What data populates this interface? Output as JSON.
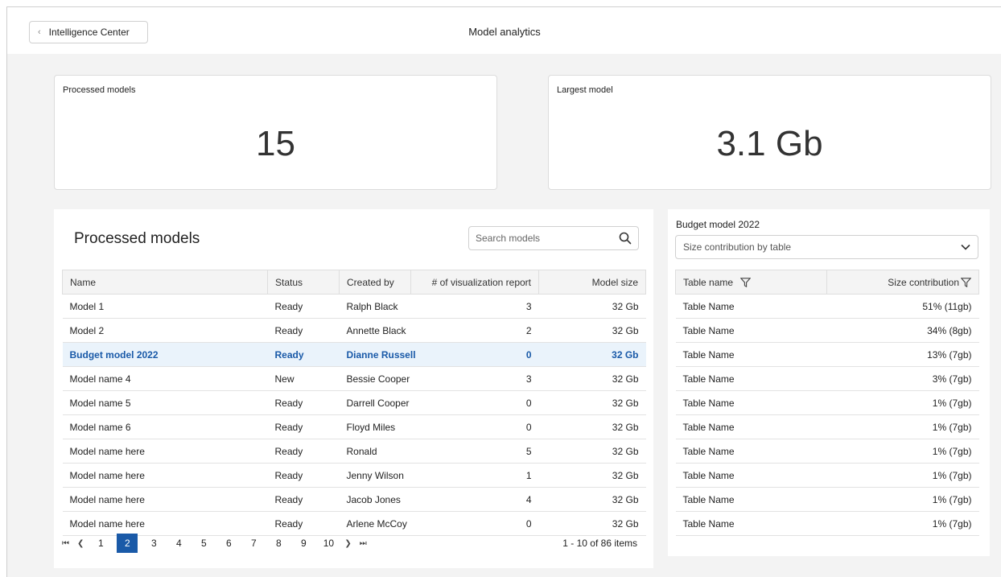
{
  "header": {
    "back_label": "Intelligence Center",
    "title": "Model analytics"
  },
  "kpis": [
    {
      "label": "Processed models",
      "value": "15"
    },
    {
      "label": "Largest model",
      "value": "3.1 Gb"
    }
  ],
  "models_panel": {
    "title": "Processed models",
    "search_placeholder": "Search models",
    "columns": [
      "Name",
      "Status",
      "Created by",
      "# of visualization report",
      "Model size"
    ],
    "rows": [
      {
        "name": "Model 1",
        "status": "Ready",
        "created_by": "Ralph Black",
        "reports": "3",
        "size": "32 Gb"
      },
      {
        "name": "Model 2",
        "status": "Ready",
        "created_by": "Annette Black",
        "reports": "2",
        "size": "32 Gb"
      },
      {
        "name": "Budget model 2022",
        "status": "Ready",
        "created_by": "Dianne Russell",
        "reports": "0",
        "size": "32 Gb"
      },
      {
        "name": "Model name 4",
        "status": "New",
        "created_by": "Bessie Cooper",
        "reports": "3",
        "size": "32 Gb"
      },
      {
        "name": "Model name 5",
        "status": "Ready",
        "created_by": "Darrell Cooper",
        "reports": "0",
        "size": "32 Gb"
      },
      {
        "name": "Model name 6",
        "status": "Ready",
        "created_by": "Floyd Miles",
        "reports": "0",
        "size": "32 Gb"
      },
      {
        "name": "Model name here",
        "status": "Ready",
        "created_by": "Ronald",
        "reports": "5",
        "size": "32 Gb"
      },
      {
        "name": "Model name here",
        "status": "Ready",
        "created_by": "Jenny Wilson",
        "reports": "1",
        "size": "32 Gb"
      },
      {
        "name": "Model name here",
        "status": "Ready",
        "created_by": "Jacob Jones",
        "reports": "4",
        "size": "32 Gb"
      },
      {
        "name": "Model name here",
        "status": "Ready",
        "created_by": "Arlene McCoy",
        "reports": "0",
        "size": "32 Gb"
      }
    ],
    "selected_row": 2,
    "pagination": {
      "pages": [
        "1",
        "2",
        "3",
        "4",
        "5",
        "6",
        "7",
        "8",
        "9",
        "10"
      ],
      "current_page": "2",
      "summary": "1 - 10 of 86 items"
    }
  },
  "detail_panel": {
    "title": "Budget model 2022",
    "view_select": "Size contribution by table",
    "columns": [
      "Table name",
      "Size contribution"
    ],
    "rows": [
      {
        "table": "Table Name",
        "contribution": "51% (11gb)"
      },
      {
        "table": "Table Name",
        "contribution": "34% (8gb)"
      },
      {
        "table": "Table Name",
        "contribution": "13% (7gb)"
      },
      {
        "table": "Table Name",
        "contribution": "3% (7gb)"
      },
      {
        "table": "Table Name",
        "contribution": "1% (7gb)"
      },
      {
        "table": "Table Name",
        "contribution": "1% (7gb)"
      },
      {
        "table": "Table Name",
        "contribution": "1% (7gb)"
      },
      {
        "table": "Table Name",
        "contribution": "1% (7gb)"
      },
      {
        "table": "Table Name",
        "contribution": "1% (7gb)"
      },
      {
        "table": "Table Name",
        "contribution": "1% (7gb)"
      }
    ]
  },
  "colors": {
    "accent": "#1a5aa8",
    "selected_row_bg": "#eaf3fb",
    "page_bg": "#f3f3f3"
  },
  "icons": {
    "back": "chevron-left-icon",
    "search": "search-icon",
    "dropdown": "chevron-down-icon",
    "filter": "filter-icon",
    "first_page": "first-page-icon",
    "prev_page": "chevron-left-icon",
    "next_page": "chevron-right-icon",
    "last_page": "last-page-icon"
  }
}
